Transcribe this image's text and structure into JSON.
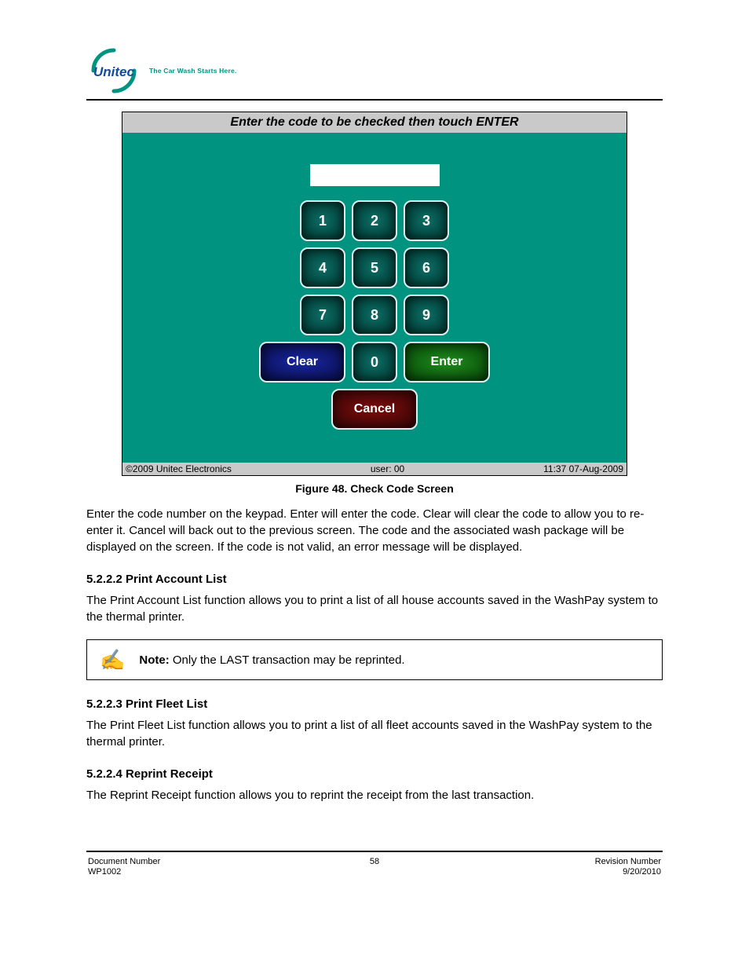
{
  "header": {
    "logo_text": "Unitec",
    "slogan": "The Car Wash Starts Here.",
    "colors": {
      "teal": "#009380",
      "logo_text": "#134a9b"
    }
  },
  "screenshot": {
    "title": "Enter the code to be checked then touch ENTER",
    "input_value": "",
    "keys": {
      "k1": "1",
      "k2": "2",
      "k3": "3",
      "k4": "4",
      "k5": "5",
      "k6": "6",
      "k7": "7",
      "k8": "8",
      "k9": "9",
      "k0": "0"
    },
    "buttons": {
      "clear": "Clear",
      "enter": "Enter",
      "cancel": "Cancel"
    },
    "status": {
      "left": "©2009 Unitec Electronics",
      "center": "user: 00",
      "right": "11:37 07-Aug-2009"
    }
  },
  "figure_caption": "Figure 48. Check Code Screen",
  "paragraphs": {
    "p1": "Enter the code number on the keypad. Enter will enter the code. Clear will clear the code to allow you to re-enter it. Cancel will back out to the previous screen. The code and the associated wash package will be displayed on the screen. If the code is not valid, an error message will be displayed.",
    "h1": "5.2.2.2 Print Account List",
    "p2": "The Print Account List function allows you to print a list of all house accounts saved in the WashPay system to the thermal printer.",
    "h2": "5.2.2.3 Print Fleet List",
    "p3": "The Print Fleet List function allows you to print a list of all fleet accounts saved in the WashPay system to the thermal printer.",
    "h3": "5.2.2.4 Reprint Receipt",
    "p4": "The Reprint Receipt function allows you to reprint the receipt from the last transaction."
  },
  "note": {
    "label": "Note:",
    "text": "Only the LAST transaction may be reprinted."
  },
  "footer": {
    "line1_left": "Document Number",
    "line2_left": "WP1002",
    "line1_right": "Revision Number",
    "line2_right": "9/20/2010",
    "center": "58"
  }
}
